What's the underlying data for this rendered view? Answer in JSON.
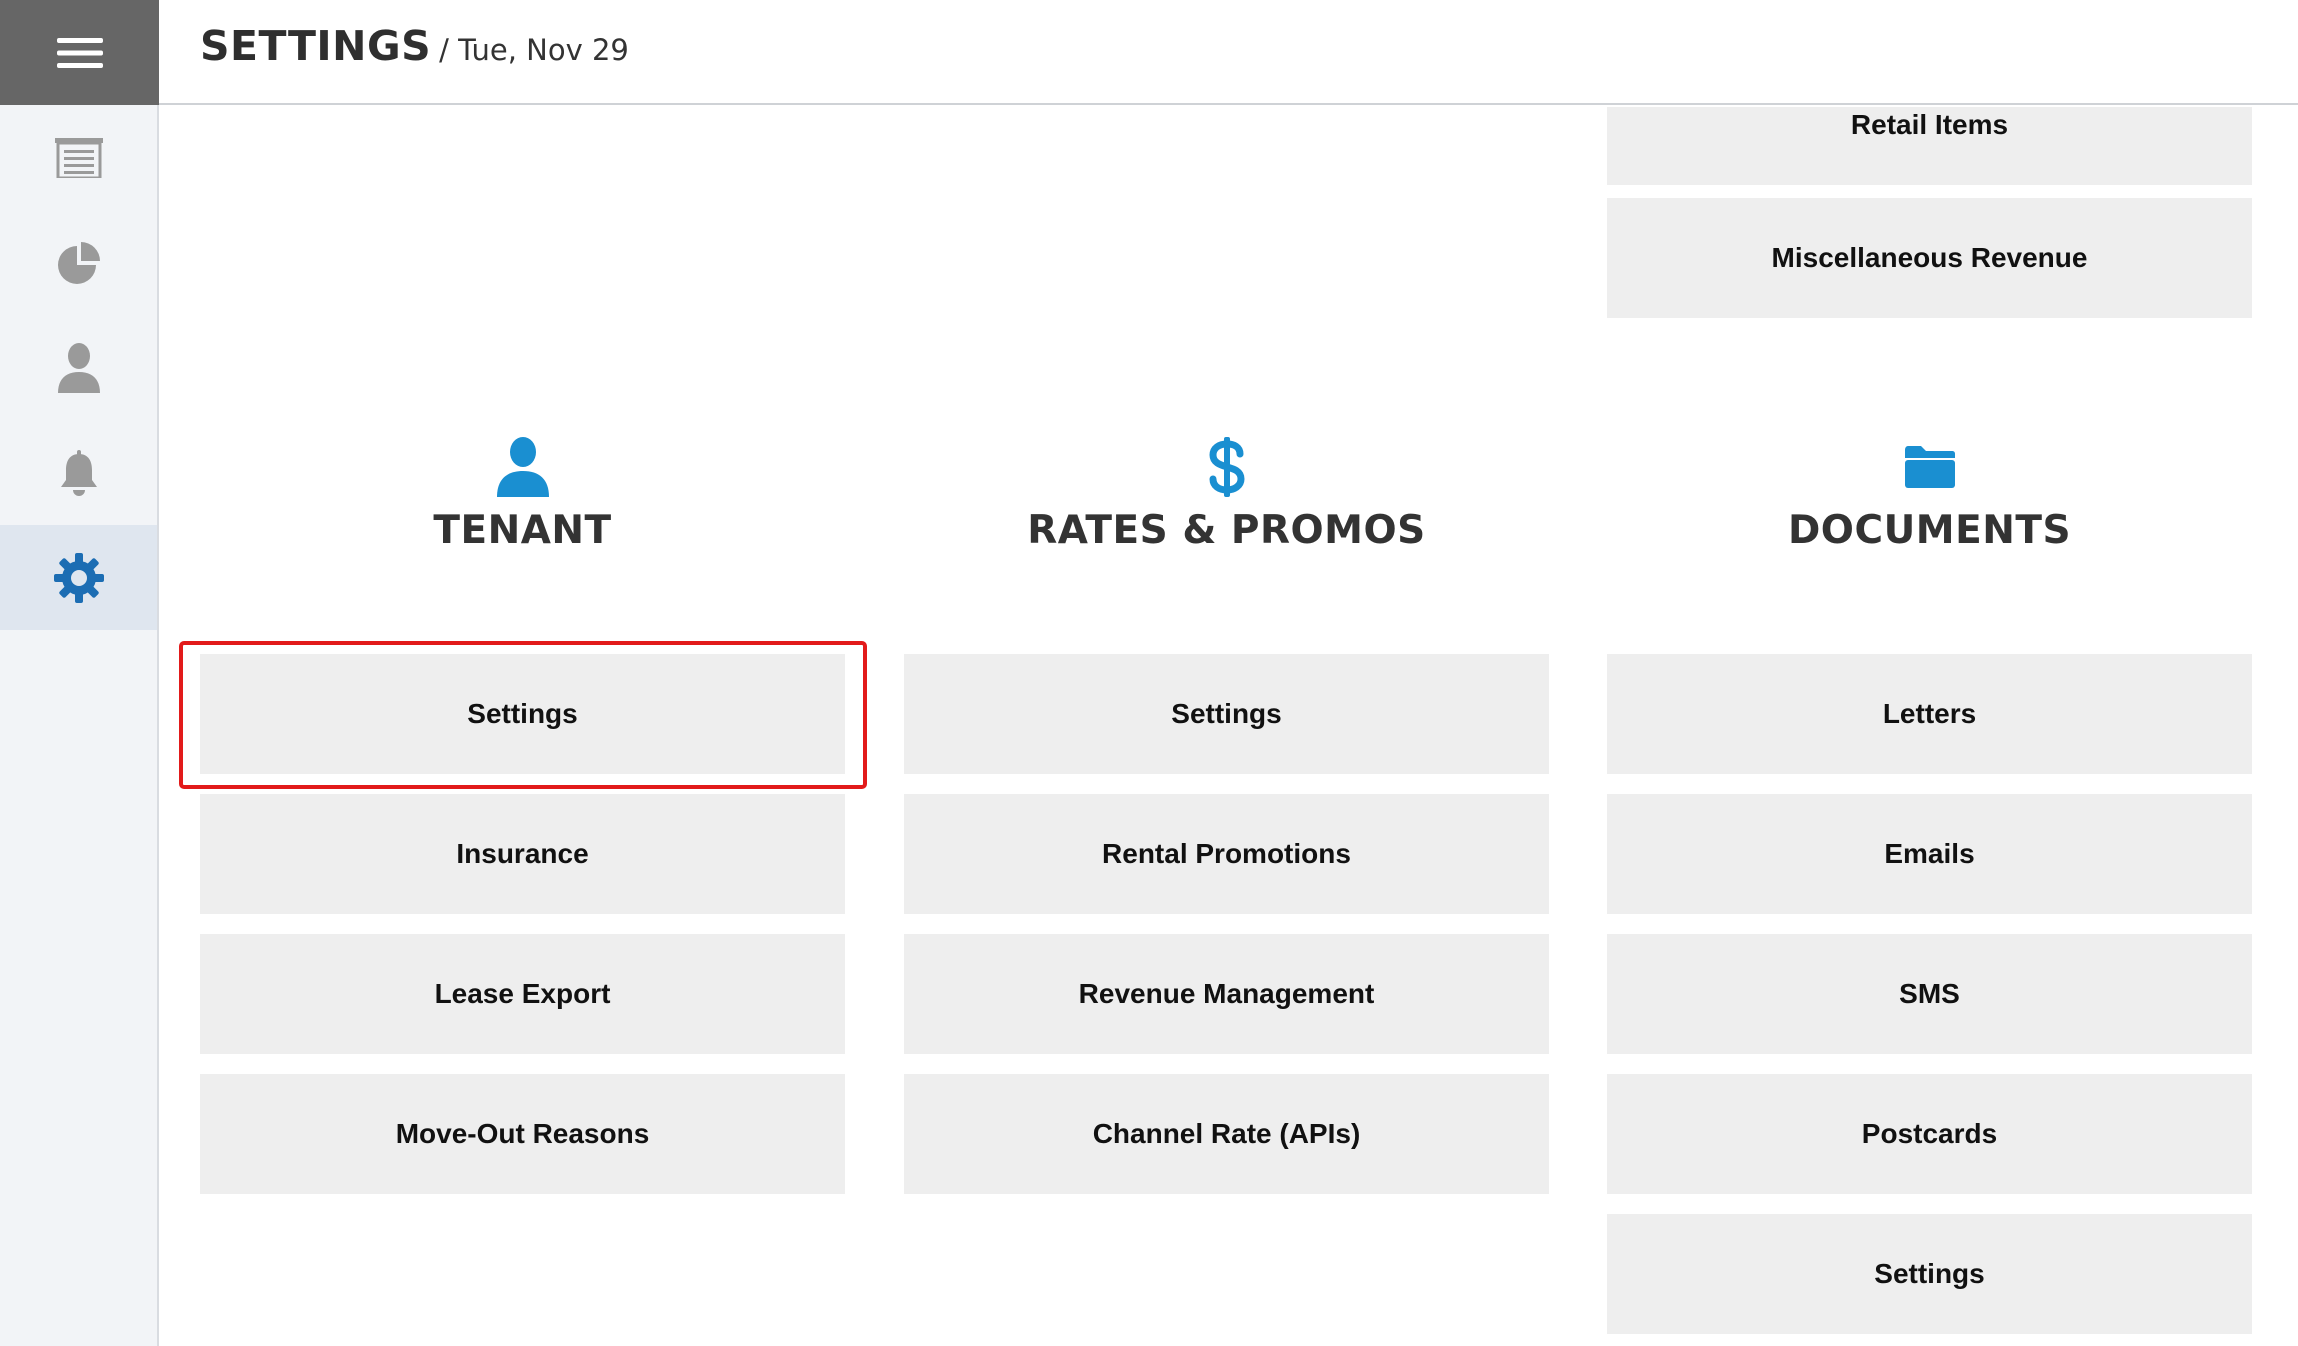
{
  "header": {
    "title": "SETTINGS",
    "date": "/ Tue, Nov 29"
  },
  "sidebar": {
    "items": [
      {
        "icon": "storage-units-icon"
      },
      {
        "icon": "pie-chart-icon"
      },
      {
        "icon": "user-icon"
      },
      {
        "icon": "bell-icon"
      },
      {
        "icon": "gear-icon",
        "active": true
      }
    ]
  },
  "top_tiles": [
    "Retail Items",
    "Miscellaneous Revenue"
  ],
  "sections": {
    "tenant": {
      "title": "TENANT",
      "icon": "user-icon",
      "items": [
        "Settings",
        "Insurance",
        "Lease Export",
        "Move-Out Reasons"
      ]
    },
    "rates": {
      "title": "RATES & PROMOS",
      "icon": "dollar-icon",
      "items": [
        "Settings",
        "Rental Promotions",
        "Revenue Management",
        "Channel Rate (APIs)"
      ]
    },
    "documents": {
      "title": "DOCUMENTS",
      "icon": "folder-icon",
      "items": [
        "Letters",
        "Emails",
        "SMS",
        "Postcards",
        "Settings"
      ]
    }
  },
  "colors": {
    "accent": "#1a8fd1",
    "highlight": "#e21a1a",
    "tile_bg": "#eeeeee"
  }
}
